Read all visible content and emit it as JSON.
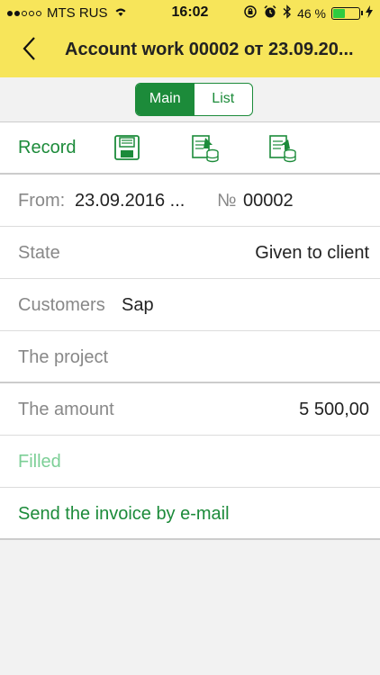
{
  "status": {
    "carrier": "MTS RUS",
    "time": "16:02",
    "battery": "46 %",
    "battery_level": 0.46
  },
  "nav": {
    "title": "Account work 00002 от 23.09.20..."
  },
  "tabs": [
    {
      "label": "Main",
      "active": true
    },
    {
      "label": "List",
      "active": false
    }
  ],
  "toolbar": {
    "record_label": "Record",
    "icons": [
      "save-icon",
      "import-icon",
      "export-icon"
    ]
  },
  "form": {
    "from_label": "From:",
    "from_value": "23.09.2016 ...",
    "number_label": "№",
    "number_value": "00002",
    "state_label": "State",
    "state_value": "Given to client",
    "customers_label": "Customers",
    "customers_value": "Sap",
    "project_label": "The project",
    "amount_label": "The amount",
    "amount_value": "5 500,00",
    "filled_label": "Filled",
    "send_label": "Send the invoice by e-mail"
  },
  "colors": {
    "header": "#f7e55a",
    "accent": "#1c8b3a",
    "accent_light": "#7ccf96"
  }
}
